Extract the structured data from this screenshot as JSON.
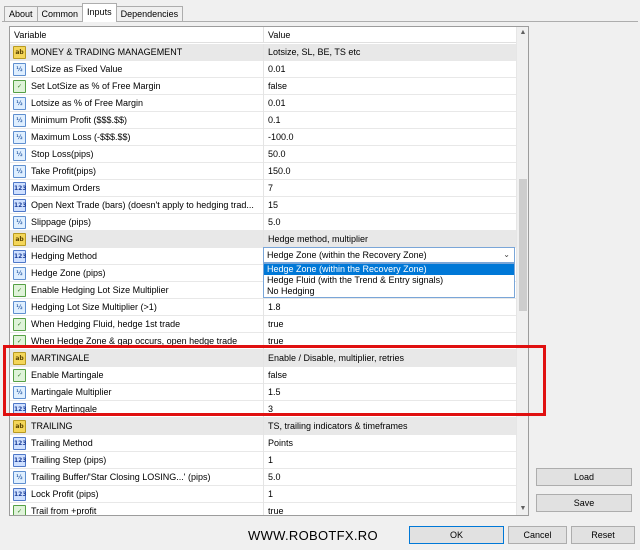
{
  "tabs": [
    "About",
    "Common",
    "Inputs",
    "Dependencies"
  ],
  "grid": {
    "headers": [
      "Variable",
      "Value"
    ],
    "rows": [
      {
        "icon": "ab",
        "name": "MONEY & TRADING MANAGEMENT",
        "value": "Lotsize, SL, BE, TS etc",
        "group": true
      },
      {
        "icon": "v2",
        "name": "LotSize as Fixed Value",
        "value": "0.01"
      },
      {
        "icon": "bool",
        "name": "Set LotSize as % of Free Margin",
        "value": "false"
      },
      {
        "icon": "v2",
        "name": "Lotsize as % of Free Margin",
        "value": "0.01"
      },
      {
        "icon": "v2",
        "name": "Minimum Profit ($$$.$$)",
        "value": "0.1"
      },
      {
        "icon": "v2",
        "name": "Maximum Loss (-$$$.$$)",
        "value": "-100.0"
      },
      {
        "icon": "v2",
        "name": "Stop Loss(pips)",
        "value": "50.0"
      },
      {
        "icon": "v2",
        "name": "Take Profit(pips)",
        "value": "150.0"
      },
      {
        "icon": "n123",
        "name": "Maximum Orders",
        "value": "7"
      },
      {
        "icon": "n123",
        "name": "Open Next Trade (bars) (doesn't apply to hedging trad...",
        "value": "15"
      },
      {
        "icon": "v2",
        "name": "Slippage (pips)",
        "value": "5.0"
      },
      {
        "icon": "ab",
        "name": "HEDGING",
        "value": "Hedge method, multiplier",
        "group": true
      },
      {
        "icon": "n123",
        "name": "Hedging Method",
        "value": "",
        "selected": true
      },
      {
        "icon": "v2",
        "name": "Hedge Zone (pips)",
        "value": ""
      },
      {
        "icon": "bool",
        "name": "Enable Hedging Lot Size Multiplier",
        "value": ""
      },
      {
        "icon": "v2",
        "name": "Hedging Lot Size Multiplier (>1)",
        "value": "1.8"
      },
      {
        "icon": "bool",
        "name": "When Hedging Fluid, hedge 1st trade",
        "value": "true"
      },
      {
        "icon": "bool",
        "name": "When Hedge Zone & gap occurs, open hedge trade",
        "value": "true"
      },
      {
        "icon": "ab",
        "name": "MARTINGALE",
        "value": "Enable / Disable, multiplier, retries",
        "group": true
      },
      {
        "icon": "bool",
        "name": "Enable Martingale",
        "value": "false"
      },
      {
        "icon": "v2",
        "name": "Martingale Multiplier",
        "value": "1.5"
      },
      {
        "icon": "n123",
        "name": "Retry Martingale",
        "value": "3"
      },
      {
        "icon": "ab",
        "name": "TRAILING",
        "value": "TS, trailing indicators & timeframes",
        "group": true
      },
      {
        "icon": "n123",
        "name": "Trailing Method",
        "value": "Points"
      },
      {
        "icon": "n123",
        "name": "Trailing Step (pips)",
        "value": "1"
      },
      {
        "icon": "v2",
        "name": "Trailing Buffer/'Star Closing LOSING...' (pips)",
        "value": "5.0"
      },
      {
        "icon": "n123",
        "name": "Lock Profit (pips)",
        "value": "1"
      },
      {
        "icon": "bool",
        "name": "Trail from +profit",
        "value": "true"
      }
    ]
  },
  "combo": {
    "selected": "Hedge Zone (within the Recovery Zone)",
    "options": [
      "Hedge Zone (within the Recovery Zone)",
      "Hedge Fluid (with the Trend & Entry signals)",
      "No Hedging"
    ]
  },
  "icons": {
    "ab": "ab",
    "v2": "½",
    "bool": "✓",
    "n123": "123"
  },
  "buttons": {
    "load": "Load",
    "save": "Save",
    "ok": "OK",
    "cancel": "Cancel",
    "reset": "Reset"
  },
  "watermark": "WWW.ROBOTFX.RO",
  "colors": {
    "highlight": "#e01010",
    "selection": "#0078d7"
  }
}
